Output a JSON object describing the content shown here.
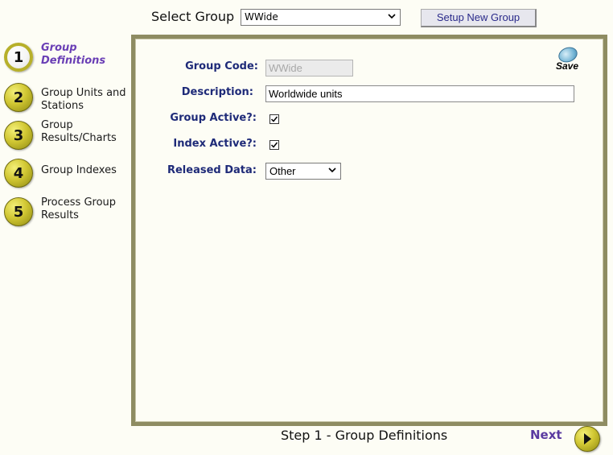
{
  "top": {
    "select_label": "Select Group",
    "selected_group": "WWide",
    "setup_button": "Setup New Group"
  },
  "steps": [
    {
      "number": "1",
      "label_line1": "Group",
      "label_line2": "Definitions",
      "active": true
    },
    {
      "number": "2",
      "label_line1": "Group Units and",
      "label_line2": "Stations",
      "active": false
    },
    {
      "number": "3",
      "label_line1": "Group",
      "label_line2": "Results/Charts",
      "active": false
    },
    {
      "number": "4",
      "label_line1": "Group Indexes",
      "label_line2": "",
      "active": false
    },
    {
      "number": "5",
      "label_line1": "Process Group",
      "label_line2": "Results",
      "active": false
    }
  ],
  "form": {
    "group_code_label": "Group Code:",
    "group_code_value": "WWide",
    "description_label": "Description:",
    "description_value": "Worldwide units",
    "group_active_label": "Group Active?:",
    "group_active_checked": true,
    "index_active_label": "Index Active?:",
    "index_active_checked": true,
    "released_data_label": "Released Data:",
    "released_data_value": "Other",
    "save_label": "Save"
  },
  "footer": {
    "step_caption": "Step 1 - Group Definitions",
    "next_label": "Next"
  },
  "icons": {
    "dropdown": "chevron-down-icon",
    "save": "disk-icon",
    "next": "arrow-right-icon",
    "check": "check-icon"
  },
  "colors": {
    "active_step_text": "#6a3fb5",
    "form_label": "#1e2a78",
    "panel_border": "#8e8c62",
    "step_gold": "#d1c733"
  }
}
